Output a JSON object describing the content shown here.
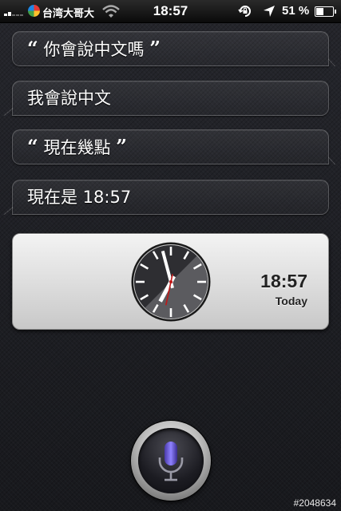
{
  "status_bar": {
    "carrier": "台湾大哥大",
    "time": "18:57",
    "battery_percent": "51 %",
    "battery_level": 0.51,
    "signal_bars": 2,
    "icons": [
      "signal-icon",
      "carrier-logo-icon",
      "wifi-icon",
      "rotation-lock-icon",
      "location-arrow-icon",
      "battery-icon"
    ]
  },
  "conversation": {
    "open_quote": "“",
    "close_quote": "”",
    "messages": [
      {
        "speaker": "user",
        "text": "你會說中文嗎"
      },
      {
        "speaker": "siri",
        "text": "我會說中文"
      },
      {
        "speaker": "user",
        "text": "現在幾點"
      },
      {
        "speaker": "siri",
        "text": "現在是 18:57"
      }
    ]
  },
  "clock_card": {
    "time": "18:57",
    "day": "Today",
    "hour": 18,
    "minute": 57,
    "second": 32,
    "colors": {
      "face_light": "#5b5b5f",
      "face_dark": "#2e2e32",
      "second_hand": "#c01818"
    }
  },
  "mic": {
    "icon": "microphone-icon",
    "color": "#6a5acd"
  },
  "watermark": "#2048634"
}
